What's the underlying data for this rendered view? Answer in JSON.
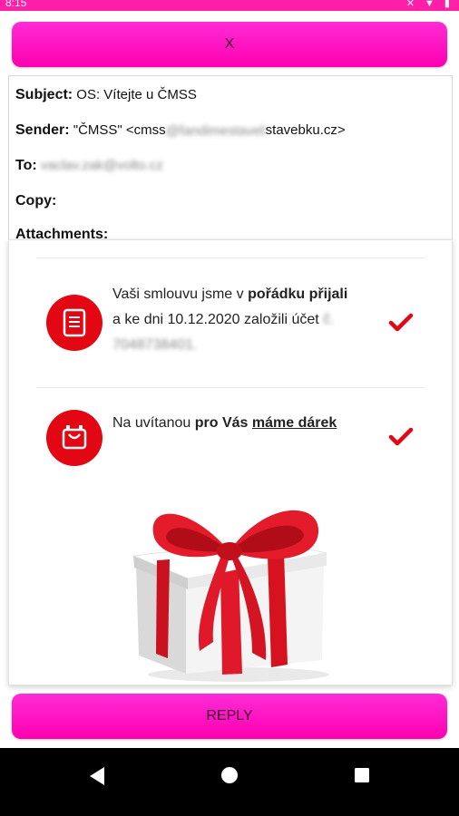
{
  "status_bar": {
    "time": "8:15"
  },
  "top_button": {
    "label": "X"
  },
  "email": {
    "subject_label": "Subject:",
    "subject_value": "OS: Vítejte u ČMSS",
    "sender_label": "Sender:",
    "sender_prefix": "\"ČMSS\" <cmss",
    "sender_blur": "@fandimestavebku.cz>",
    "sender_suffix": "stavebku.cz>",
    "to_label": "To:",
    "to_value": "vaclav.zak@volto.cz",
    "copy_label": "Copy:",
    "attachments_label": "Attachments:"
  },
  "items": [
    {
      "icon": "document-icon",
      "text_a": "Vaši smlouvu jsme v ",
      "text_b": "pořádku přijali",
      "text_c": " a ke dni 10.12.2020 založili účet ",
      "text_blur": "č. 7048738401."
    },
    {
      "icon": "gift-bag-icon",
      "text_a": "Na uvítanou ",
      "text_b": "pro Vás",
      "text_c": " ",
      "text_link": "máme dárek"
    }
  ],
  "accent_color": "#e30613",
  "button_color": "#ff1fc8",
  "reply_button": {
    "label": "REPLY"
  }
}
